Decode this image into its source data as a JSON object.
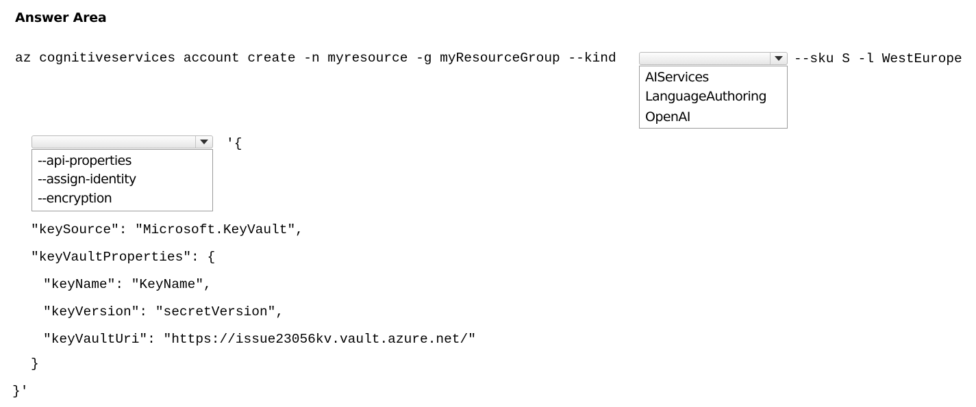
{
  "heading": "Answer Area",
  "command": {
    "prefix": "az cognitiveservices account create -n myresource -g myResourceGroup --kind",
    "suffix": "--sku S -l WestEurope"
  },
  "kind_dropdown": {
    "selected": "",
    "options": [
      "AIServices",
      "LanguageAuthoring",
      "OpenAI"
    ]
  },
  "param_dropdown": {
    "selected": "",
    "options": [
      "--api-properties",
      "--assign-identity",
      "--encryption"
    ]
  },
  "json_block": {
    "open": "'{",
    "lines": [
      "\"keySource\": \"Microsoft.KeyVault\",",
      "\"keyVaultProperties\": {",
      "\"keyName\": \"KeyName\",",
      "\"keyVersion\": \"secretVersion\",",
      "\"keyVaultUri\": \"https://issue23056kv.vault.azure.net/\"",
      "}"
    ],
    "close": "}'"
  }
}
